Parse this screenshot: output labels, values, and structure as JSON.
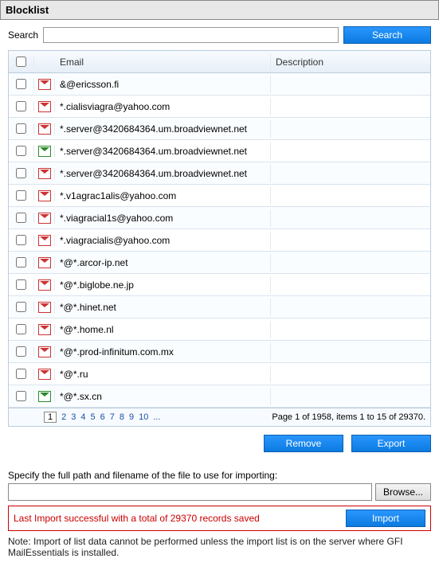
{
  "title": "Blocklist",
  "search": {
    "label": "Search",
    "value": "",
    "button": "Search"
  },
  "columns": {
    "email": "Email",
    "description": "Description"
  },
  "rows": [
    {
      "email": "&@ericsson.fi",
      "desc": "",
      "icon": "red"
    },
    {
      "email": "*.cialisviagra@yahoo.com",
      "desc": "",
      "icon": "red"
    },
    {
      "email": "*.server@3420684364.um.broadviewnet.net",
      "desc": "",
      "icon": "red"
    },
    {
      "email": "*.server@3420684364.um.broadviewnet.net",
      "desc": "",
      "icon": "green"
    },
    {
      "email": "*.server@3420684364.um.broadviewnet.net",
      "desc": "",
      "icon": "red"
    },
    {
      "email": "*.v1agrac1alis@yahoo.com",
      "desc": "",
      "icon": "red"
    },
    {
      "email": "*.viagracial1s@yahoo.com",
      "desc": "",
      "icon": "red"
    },
    {
      "email": "*.viagracialis@yahoo.com",
      "desc": "",
      "icon": "red"
    },
    {
      "email": "*@*.arcor-ip.net",
      "desc": "",
      "icon": "red"
    },
    {
      "email": "*@*.biglobe.ne.jp",
      "desc": "",
      "icon": "red"
    },
    {
      "email": "*@*.hinet.net",
      "desc": "",
      "icon": "red"
    },
    {
      "email": "*@*.home.nl",
      "desc": "",
      "icon": "red"
    },
    {
      "email": "*@*.prod-infinitum.com.mx",
      "desc": "",
      "icon": "red"
    },
    {
      "email": "*@*.ru",
      "desc": "",
      "icon": "red"
    },
    {
      "email": "*@*.sx.cn",
      "desc": "",
      "icon": "green"
    }
  ],
  "pager": {
    "pages": [
      "1",
      "2",
      "3",
      "4",
      "5",
      "6",
      "7",
      "8",
      "9",
      "10",
      "..."
    ],
    "current": "1",
    "status": "Page 1 of 1958, items 1 to 15 of 29370."
  },
  "buttons": {
    "remove": "Remove",
    "export": "Export",
    "browse": "Browse...",
    "import": "Import"
  },
  "import": {
    "label": "Specify the full path and filename of the file to use for importing:",
    "value": "",
    "status": "Last Import successful with a total of 29370 records saved"
  },
  "note": "Note: Import of list data cannot be performed unless the import list is on the server where GFI MailEssentials is installed."
}
